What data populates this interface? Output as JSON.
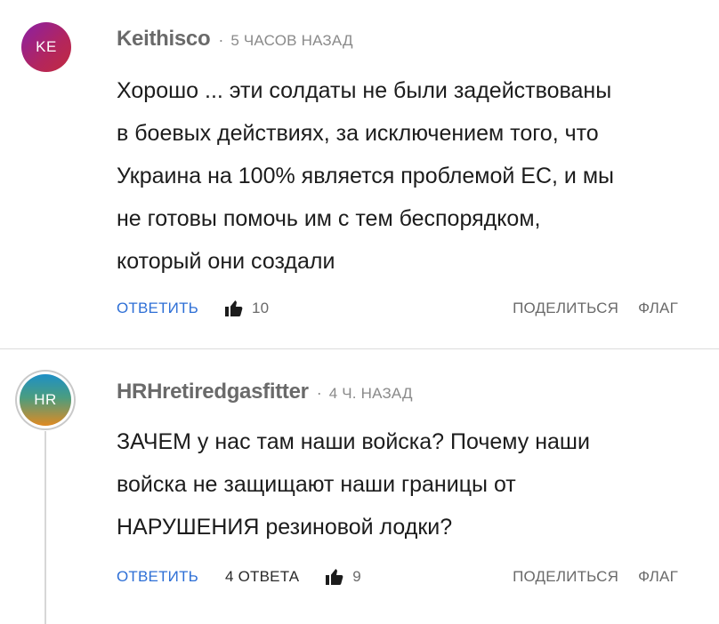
{
  "comments": [
    {
      "avatar_initials": "KE",
      "author": "Keithisco",
      "time": "5 часов назад",
      "text_lines": [
        "Хорошо ... эти солдаты не были задействованы",
        "в боевых действиях, за исключением того, что",
        "Украина на 100% является проблемой ЕС, и мы",
        "не готовы помочь им с тем беспорядком,",
        "который они создали"
      ],
      "reply_label": "Ответить",
      "likes": "10",
      "share_label": "Поделиться",
      "flag_label": "Флаг"
    },
    {
      "avatar_initials": "HR",
      "author": "HRHretiredgasfitter",
      "time": "4 ч. назад",
      "text_lines": [
        "ЗАЧЕМ у нас там наши войска? Почему наши",
        "войска не защищают наши границы от",
        "НАРУШЕНИЯ резиновой лодки?"
      ],
      "reply_label": "Ответить",
      "replies_label": "4 ответа",
      "likes": "9",
      "share_label": "Поделиться",
      "flag_label": "Флаг"
    }
  ],
  "colors": {
    "reply_link": "#2e6fd6",
    "meta_text": "#6a6a6a",
    "body_text": "#1c1c1c"
  },
  "icons": [
    "thumbs-up-icon"
  ]
}
